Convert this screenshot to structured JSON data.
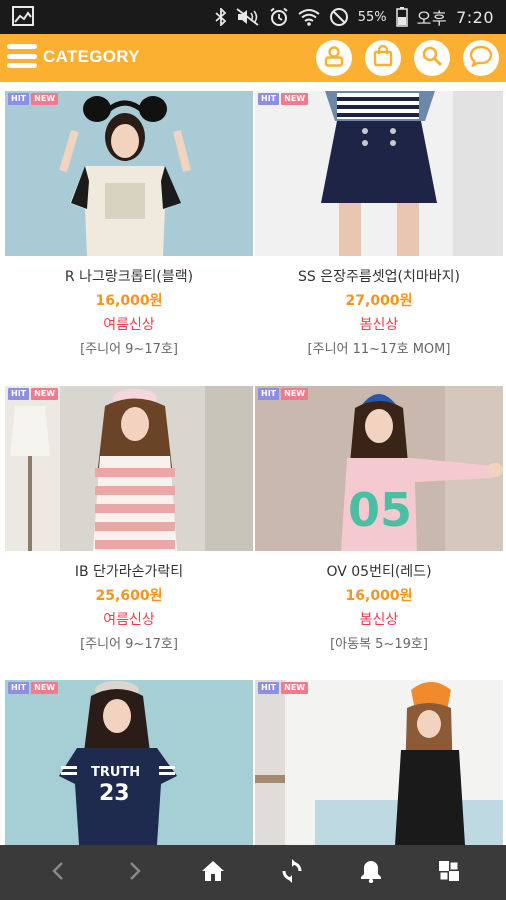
{
  "status_bar": {
    "battery_percent": "55%",
    "ampm": "오후",
    "time": "7:20"
  },
  "header": {
    "category_label": "CATEGORY",
    "accent_color": "#fbb032",
    "icons": [
      "menu-icon",
      "user-icon",
      "shopping-bag-icon",
      "search-icon",
      "chat-icon"
    ]
  },
  "badges": {
    "hit": "HIT",
    "new": "NEW"
  },
  "products": [
    {
      "name": "R 나그랑크롭티(블랙)",
      "price": "16,000원",
      "tag": "여름신상",
      "size": "[주니어 9~17호]"
    },
    {
      "name": "SS 은장주름셋업(치마바지)",
      "price": "27,000원",
      "tag": "봄신상",
      "size": "[주니어 11~17호 MOM]"
    },
    {
      "name": "IB 단가라손가락티",
      "price": "25,600원",
      "tag": "여름신상",
      "size": "[주니어 9~17호]"
    },
    {
      "name": "OV 05번티(레드)",
      "price": "16,000원",
      "tag": "봄신상",
      "size": "[아동복 5~19호]"
    },
    {
      "name": "",
      "price": "",
      "tag": "",
      "size": ""
    },
    {
      "name": "",
      "price": "",
      "tag": "",
      "size": ""
    }
  ],
  "bottom_nav": {
    "icons": [
      "back-arrow-icon",
      "forward-arrow-icon",
      "home-icon",
      "refresh-icon",
      "bell-icon",
      "grid-icon"
    ],
    "background": "#3a3a3a"
  }
}
